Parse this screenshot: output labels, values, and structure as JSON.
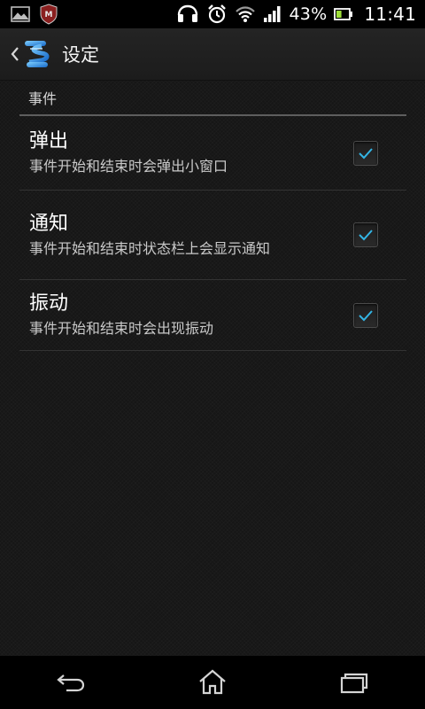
{
  "status_bar": {
    "left_icons": [
      "gallery-icon",
      "mcafee-icon"
    ],
    "right_icons": [
      "headset-icon",
      "alarm-icon",
      "wifi-icon",
      "signal-icon",
      "battery-icon"
    ],
    "battery_percent": "43%",
    "battery_level": 0.43,
    "time": "11:41"
  },
  "action_bar": {
    "back_icon": "chevron-left-icon",
    "app_icon": "app-logo-icon",
    "title": "设定"
  },
  "settings": {
    "section_title": "事件",
    "items": [
      {
        "title": "弹出",
        "summary": "事件开始和结束时会弹出小窗口",
        "checked": true
      },
      {
        "title": "通知",
        "summary": "事件开始和结束时状态栏上会显示通知",
        "checked": true
      },
      {
        "title": "振动",
        "summary": "事件开始和结束时会出现振动",
        "checked": true
      }
    ]
  },
  "nav_bar": {
    "icons": [
      "back-icon",
      "home-icon",
      "recent-apps-icon"
    ]
  },
  "colors": {
    "check_accent": "#33b5e5",
    "background": "#161616",
    "divider": "#5e5e5e"
  }
}
